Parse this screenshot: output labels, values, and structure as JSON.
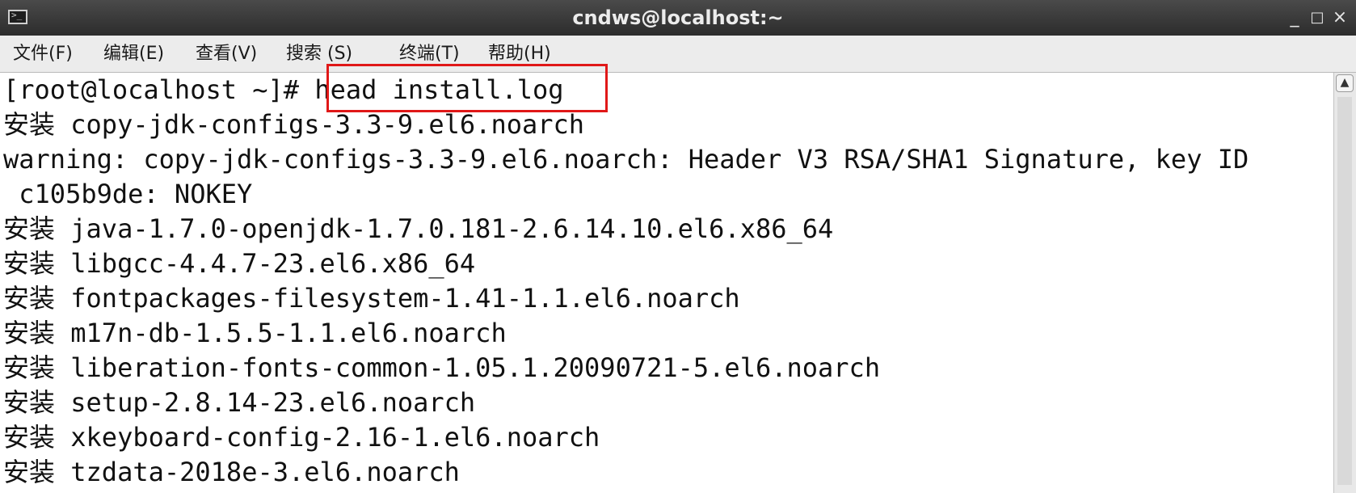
{
  "window": {
    "title": "cndws@localhost:~",
    "minimize_glyph": "_",
    "maximize_glyph": "□",
    "close_glyph": "×"
  },
  "menu": [
    {
      "label": "文件(F)"
    },
    {
      "label": "编辑(E)"
    },
    {
      "label": "查看(V)"
    },
    {
      "label": "搜索 (S)"
    },
    {
      "label": "终端(T)"
    },
    {
      "label": "帮助(H)"
    }
  ],
  "terminal": {
    "prompt": "[root@localhost ~]# ",
    "command": "head install.log",
    "lines": [
      "安装 copy-jdk-configs-3.3-9.el6.noarch",
      "warning: copy-jdk-configs-3.3-9.el6.noarch: Header V3 RSA/SHA1 Signature, key ID",
      " c105b9de: NOKEY",
      "安装 java-1.7.0-openjdk-1.7.0.181-2.6.14.10.el6.x86_64",
      "安装 libgcc-4.4.7-23.el6.x86_64",
      "安装 fontpackages-filesystem-1.41-1.1.el6.noarch",
      "安装 m17n-db-1.5.5-1.1.el6.noarch",
      "安装 liberation-fonts-common-1.05.1.20090721-5.el6.noarch",
      "安装 setup-2.8.14-23.el6.noarch",
      "安装 xkeyboard-config-2.16-1.el6.noarch",
      "安装 tzdata-2018e-3.el6.noarch"
    ]
  },
  "annotation": {
    "highlight_color": "#e01818"
  },
  "icons": {
    "app": "terminal-icon",
    "scroll_up": "scroll-up-arrow-icon"
  }
}
